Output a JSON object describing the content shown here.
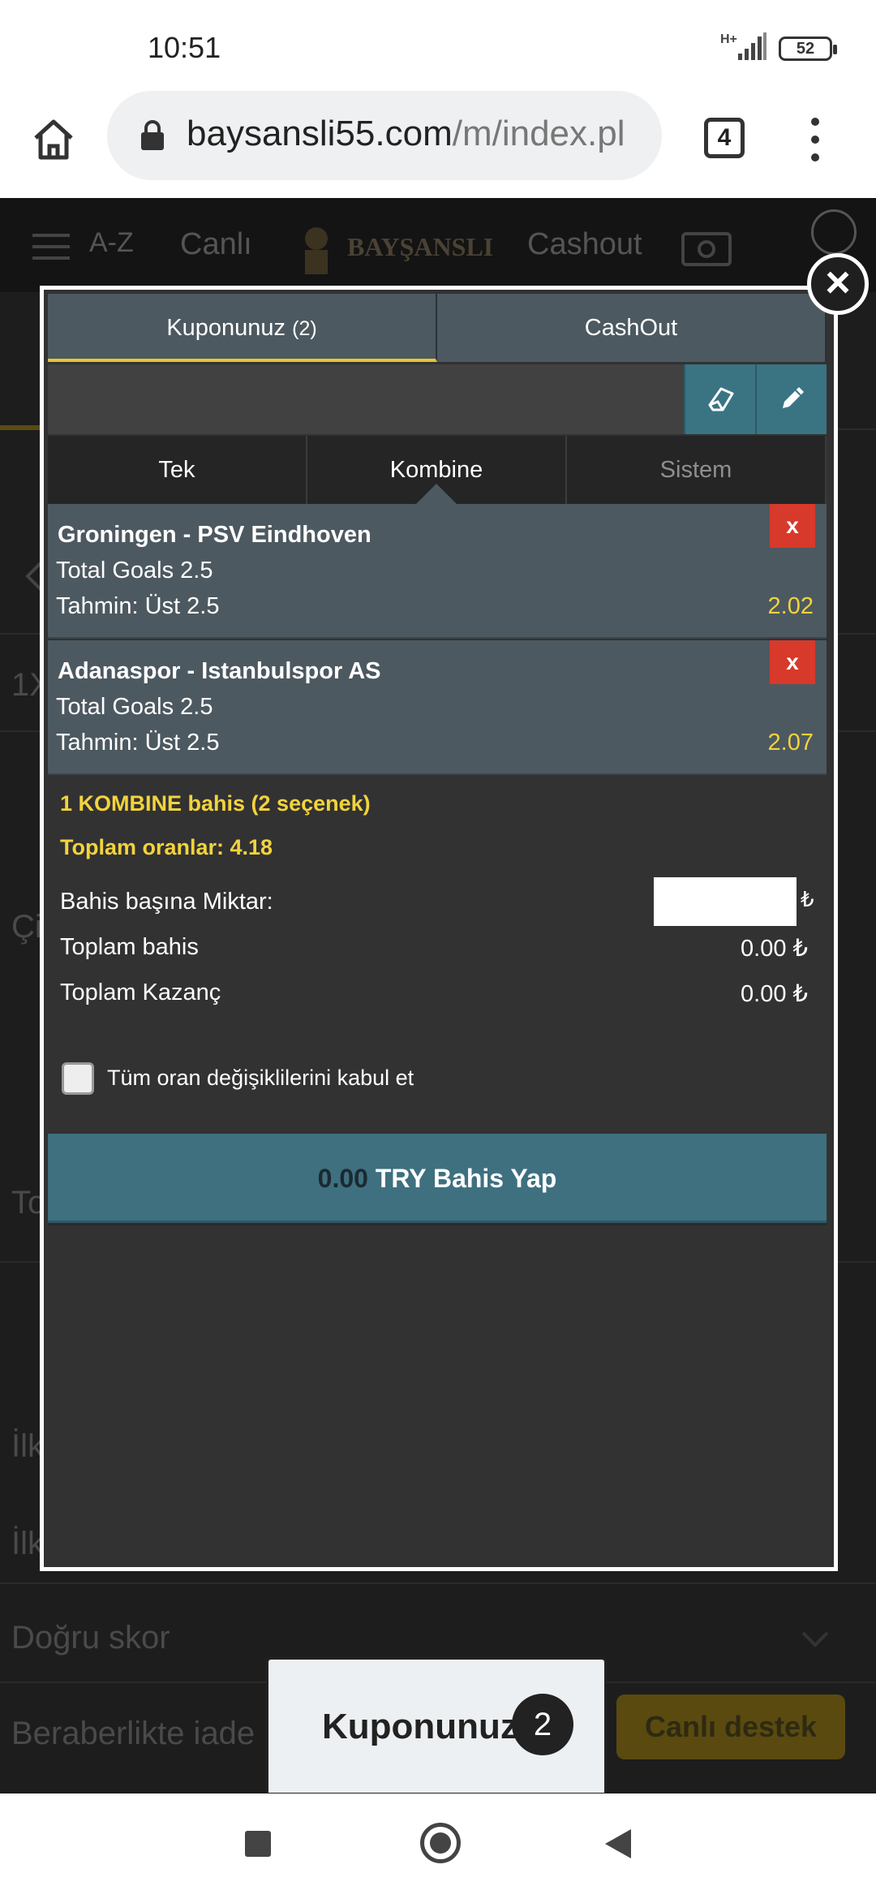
{
  "status_bar": {
    "time": "10:51",
    "network": "H+",
    "battery": "52"
  },
  "browser": {
    "url_host": "baysansli55.com",
    "url_path": "/m/index.pl",
    "tab_count": "4"
  },
  "site_header": {
    "az": "A-Z",
    "live": "Canlı",
    "logo": "BAYŞANSLI",
    "cashout": "Cashout"
  },
  "background_rows": [
    "1X",
    "Çi",
    "To",
    "İlk",
    "İlk",
    "Doğru skor",
    "Beraberlikte iade"
  ],
  "live_support": "Canlı destek",
  "coupon_tab": {
    "label": "Kuponunuz",
    "count": "2"
  },
  "modal": {
    "close_label": "×",
    "tabs": [
      {
        "label": "Kuponunuz",
        "count": "(2)"
      },
      {
        "label": "CashOut"
      }
    ],
    "bet_types": [
      "Tek",
      "Kombine",
      "Sistem"
    ],
    "selections": [
      {
        "match": "Groningen - PSV Eindhoven",
        "market": "Total Goals 2.5",
        "pick": "Tahmin: Üst 2.5",
        "odds": "2.02",
        "remove": "x"
      },
      {
        "match": "Adanaspor - Istanbulspor AS",
        "market": "Total Goals 2.5",
        "pick": "Tahmin: Üst 2.5",
        "odds": "2.07",
        "remove": "x"
      }
    ],
    "summary": {
      "combo_line": "1 KOMBINE bahis (2 seçenek)",
      "total_odds": "Toplam oranlar: 4.18"
    },
    "form": {
      "stake_label": "Bahis başına Miktar:",
      "stake_value": "",
      "currency": "₺",
      "total_bet_label": "Toplam bahis",
      "total_bet_value": "0.00 ₺",
      "total_win_label": "Toplam Kazanç",
      "total_win_value": "0.00 ₺"
    },
    "accept_changes_label": "Tüm oran değişiklilerini kabul et",
    "place_bet": {
      "amount": "0.00",
      "label": " TRY Bahis Yap"
    }
  },
  "colors": {
    "accent_yellow": "#f2d33d",
    "teal": "#3e7080",
    "remove_red": "#d73a2b",
    "panel_gray": "#4d5960"
  }
}
